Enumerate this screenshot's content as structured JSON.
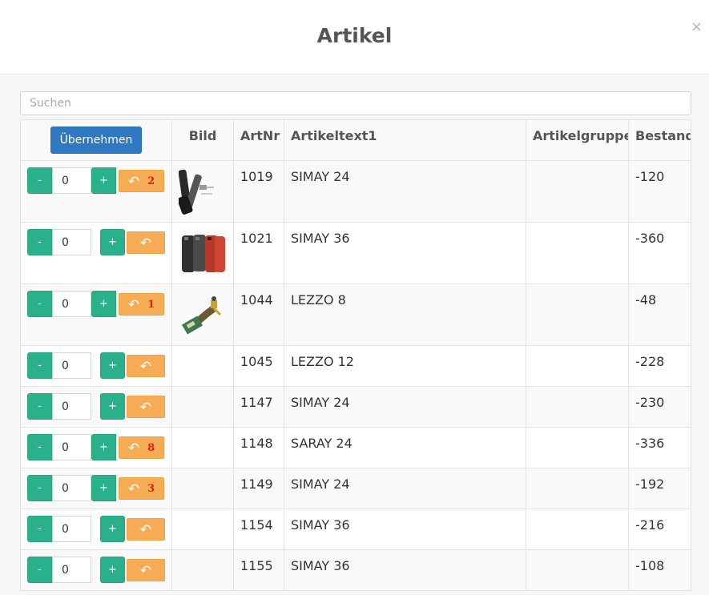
{
  "modal": {
    "title": "Artikel",
    "close_label": "×"
  },
  "search": {
    "placeholder": "Suchen",
    "value": ""
  },
  "table": {
    "accept_button_label": "Übernehmen",
    "columns": {
      "bild": "Bild",
      "artnr": "ArtNr",
      "artikeltext1": "Artikeltext1",
      "artikelgruppe": "Artikelgruppe",
      "bestand": "Bestand"
    },
    "minus_label": "-",
    "plus_label": "+",
    "return_icon": "undo-icon",
    "rows": [
      {
        "qty": "0",
        "return_count": "2",
        "image": "product-phone-case-white",
        "artnr": "1019",
        "text": "SIMAY 24",
        "gruppe": "",
        "bestand": "-120"
      },
      {
        "qty": "0",
        "return_count": "",
        "image": "product-phone-cases-red-black",
        "artnr": "1021",
        "text": "SIMAY 36",
        "gruppe": "",
        "bestand": "-360"
      },
      {
        "qty": "0",
        "return_count": "1",
        "image": "product-flex-cable",
        "artnr": "1044",
        "text": "LEZZO 8",
        "gruppe": "",
        "bestand": "-48"
      },
      {
        "qty": "0",
        "return_count": "",
        "image": "",
        "artnr": "1045",
        "text": "LEZZO 12",
        "gruppe": "",
        "bestand": "-228"
      },
      {
        "qty": "0",
        "return_count": "",
        "image": "",
        "artnr": "1147",
        "text": "SIMAY 24",
        "gruppe": "",
        "bestand": "-230"
      },
      {
        "qty": "0",
        "return_count": "8",
        "image": "",
        "artnr": "1148",
        "text": "SARAY 24",
        "gruppe": "",
        "bestand": "-336"
      },
      {
        "qty": "0",
        "return_count": "3",
        "image": "",
        "artnr": "1149",
        "text": "SIMAY 24",
        "gruppe": "",
        "bestand": "-192"
      },
      {
        "qty": "0",
        "return_count": "",
        "image": "",
        "artnr": "1154",
        "text": "SIMAY 36",
        "gruppe": "",
        "bestand": "-216"
      },
      {
        "qty": "0",
        "return_count": "",
        "image": "",
        "artnr": "1155",
        "text": "SIMAY 36",
        "gruppe": "",
        "bestand": "-108"
      }
    ]
  },
  "colors": {
    "primary": "#2f78c2",
    "success": "#2ab18b",
    "warning": "#f5ac54",
    "count_red": "#e8191a"
  }
}
